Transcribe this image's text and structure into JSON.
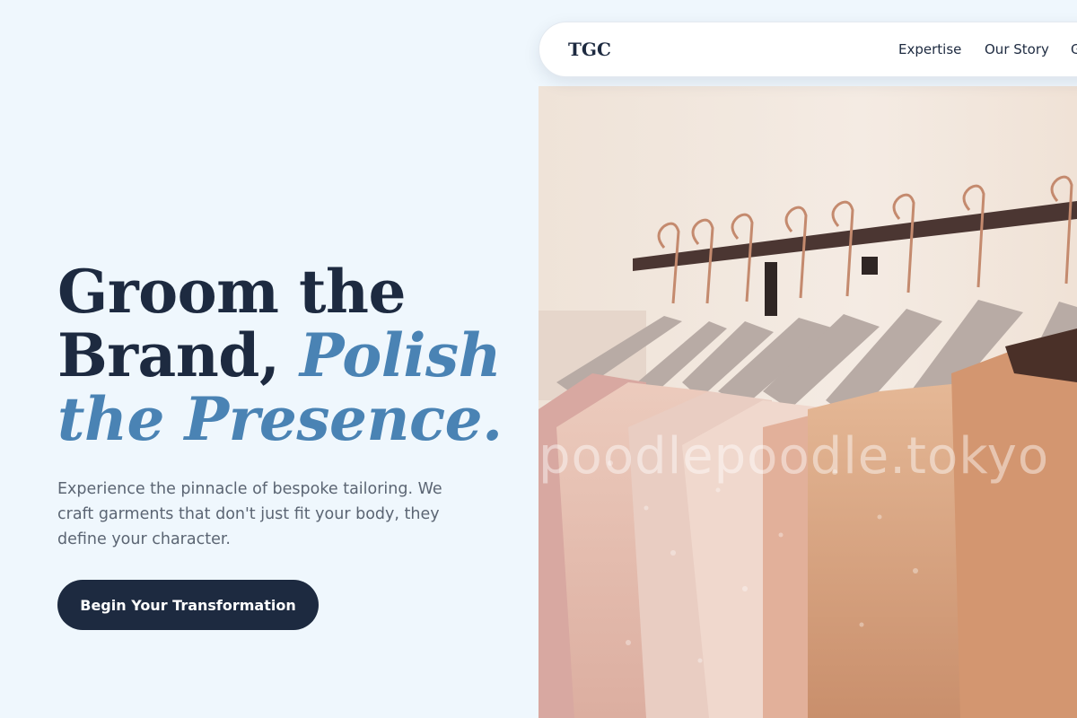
{
  "header": {
    "logo": "TGC",
    "nav": [
      {
        "label": "Expertise"
      },
      {
        "label": "Our Story"
      },
      {
        "label": "G"
      }
    ]
  },
  "hero": {
    "headline_line1": "Groom the",
    "headline_line2_plain": "Brand,",
    "headline_line2_accent": "Polish",
    "headline_line3_accent": "the Presence.",
    "subtext": "Experience the pinnacle of bespoke tailoring. We craft garments that don't just fit your body, they define your character.",
    "cta_label": "Begin Your Transformation"
  },
  "image": {
    "description_icon": "clothing-rack-photo",
    "watermark": "poodlepoodle.tokyo"
  },
  "colors": {
    "background": "#eff7fd",
    "navy": "#1d2a40",
    "accent_blue": "#4a83b4",
    "body_text": "#5b6573"
  }
}
